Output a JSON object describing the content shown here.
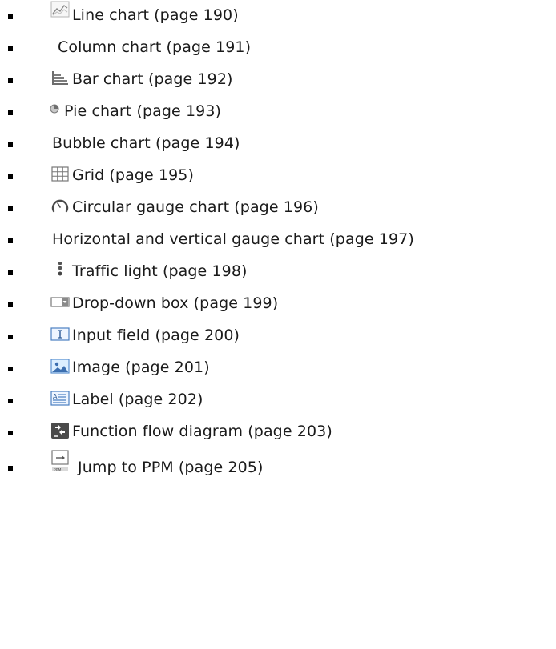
{
  "items": [
    {
      "label": "Line chart (page 190)",
      "icon": "line-chart-icon"
    },
    {
      "label": "Column chart (page 191)",
      "icon": ""
    },
    {
      "label": "Bar chart (page 192)",
      "icon": "bar-chart-icon"
    },
    {
      "label": "Pie chart (page 193)",
      "icon": "pie-chart-icon"
    },
    {
      "label": "Bubble chart (page 194)",
      "icon": ""
    },
    {
      "label": "Grid (page 195)",
      "icon": "grid-icon"
    },
    {
      "label": "Circular gauge chart (page 196)",
      "icon": "circular-gauge-icon"
    },
    {
      "label": "Horizontal and vertical gauge chart (page 197)",
      "icon": ""
    },
    {
      "label": "Traffic light (page 198)",
      "icon": "traffic-light-icon"
    },
    {
      "label": "Drop-down box (page 199)",
      "icon": "drop-down-box-icon"
    },
    {
      "label": "Input field (page 200)",
      "icon": "input-field-icon"
    },
    {
      "label": "Image (page 201)",
      "icon": "image-icon"
    },
    {
      "label": "Label (page 202)",
      "icon": "label-icon"
    },
    {
      "label": "Function flow diagram (page 203)",
      "icon": "function-flow-diagram-icon"
    },
    {
      "label": "Jump to PPM (page 205)",
      "icon": "jump-to-ppm-icon"
    }
  ]
}
